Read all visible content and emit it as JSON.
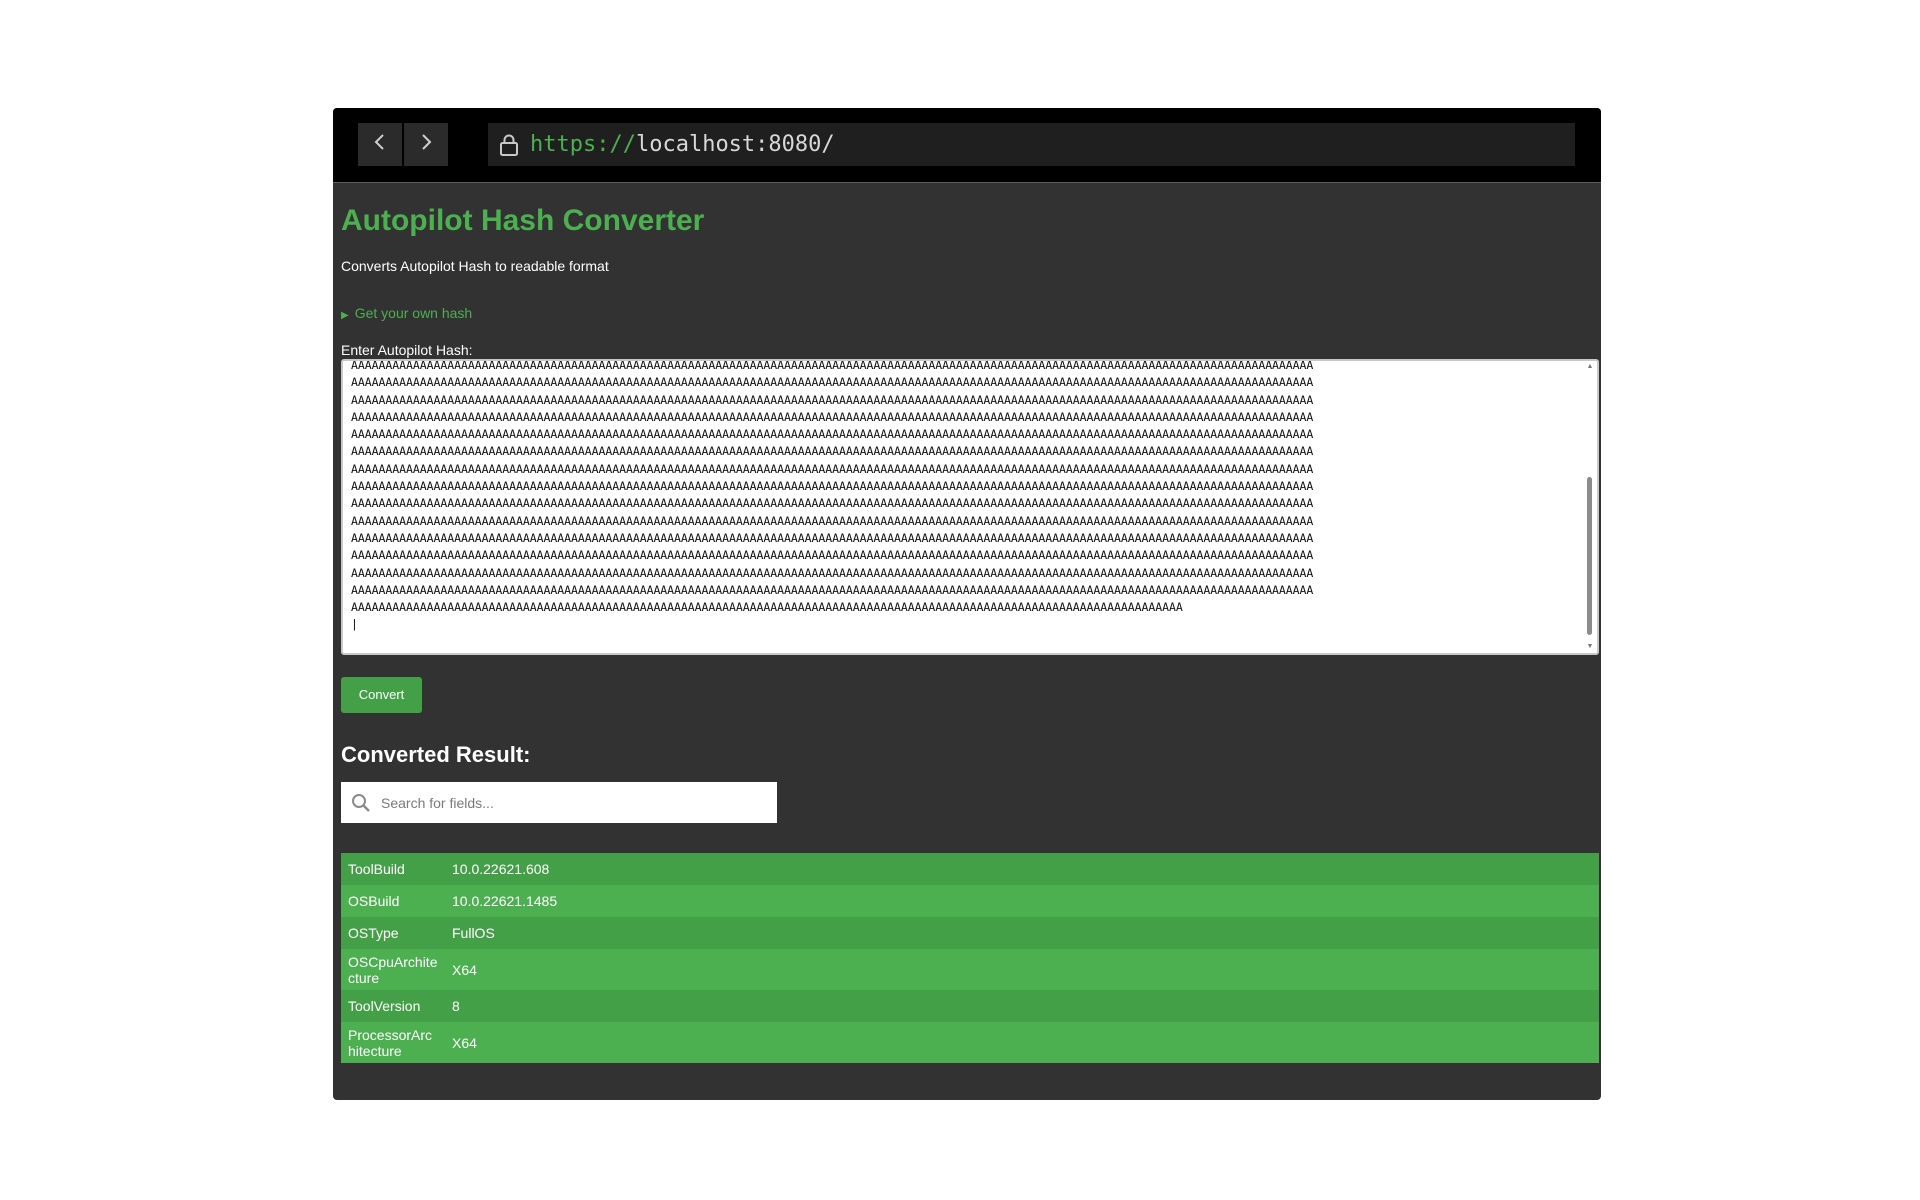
{
  "browser": {
    "url_scheme": "https://",
    "url_host": "localhost:8080/"
  },
  "page": {
    "title": "Autopilot Hash Converter",
    "subtitle": "Converts Autopilot Hash to readable format",
    "details_summary": "Get your own hash",
    "hash_label": "Enter Autopilot Hash:",
    "hash_lines": [
      "AAAAAAAAAAAAAAAAAAAAAAAAAAAAAAAAAAAAAAAAAAAAAAAAAAAAAAAAAAAAAAAAAAAAAAAAAAAAAAAAAAAAAAAAAAAAAAAAAAAAAAAAAAAAAAAAAAAAAAAAAAAAAAAAAAAAAAAAAAAA",
      "AAAAAAAAAAAAAAAAAAAAAAAAAAAAAAAAAAAAAAAAAAAAAAAAAAAAAAAAAAAAAAAAAAAAAAAAAAAAAAAAAAAAAAAAAAAAAAAAAAAAAAAAAAAAAAAAAAAAAAAAAAAAAAAAAAAAAAAAAAAA",
      "AAAAAAAAAAAAAAAAAAAAAAAAAAAAAAAAAAAAAAAAAAAAAAAAAAAAAAAAAAAAAAAAAAAAAAAAAAAAAAAAAAAAAAAAAAAAAAAAAAAAAAAAAAAAAAAAAAAAAAAAAAAAAAAAAAAAAAAAAAAA",
      "AAAAAAAAAAAAAAAAAAAAAAAAAAAAAAAAAAAAAAAAAAAAAAAAAAAAAAAAAAAAAAAAAAAAAAAAAAAAAAAAAAAAAAAAAAAAAAAAAAAAAAAAAAAAAAAAAAAAAAAAAAAAAAAAAAAAAAAAAAAA",
      "AAAAAAAAAAAAAAAAAAAAAAAAAAAAAAAAAAAAAAAAAAAAAAAAAAAAAAAAAAAAAAAAAAAAAAAAAAAAAAAAAAAAAAAAAAAAAAAAAAAAAAAAAAAAAAAAAAAAAAAAAAAAAAAAAAAAAAAAAAAA",
      "AAAAAAAAAAAAAAAAAAAAAAAAAAAAAAAAAAAAAAAAAAAAAAAAAAAAAAAAAAAAAAAAAAAAAAAAAAAAAAAAAAAAAAAAAAAAAAAAAAAAAAAAAAAAAAAAAAAAAAAAAAAAAAAAAAAAAAAAAAAA",
      "AAAAAAAAAAAAAAAAAAAAAAAAAAAAAAAAAAAAAAAAAAAAAAAAAAAAAAAAAAAAAAAAAAAAAAAAAAAAAAAAAAAAAAAAAAAAAAAAAAAAAAAAAAAAAAAAAAAAAAAAAAAAAAAAAAAAAAAAAAAA",
      "AAAAAAAAAAAAAAAAAAAAAAAAAAAAAAAAAAAAAAAAAAAAAAAAAAAAAAAAAAAAAAAAAAAAAAAAAAAAAAAAAAAAAAAAAAAAAAAAAAAAAAAAAAAAAAAAAAAAAAAAAAAAAAAAAAAAAAAAAAAA",
      "AAAAAAAAAAAAAAAAAAAAAAAAAAAAAAAAAAAAAAAAAAAAAAAAAAAAAAAAAAAAAAAAAAAAAAAAAAAAAAAAAAAAAAAAAAAAAAAAAAAAAAAAAAAAAAAAAAAAAAAAAAAAAAAAAAAAAAAAAAAA",
      "AAAAAAAAAAAAAAAAAAAAAAAAAAAAAAAAAAAAAAAAAAAAAAAAAAAAAAAAAAAAAAAAAAAAAAAAAAAAAAAAAAAAAAAAAAAAAAAAAAAAAAAAAAAAAAAAAAAAAAAAAAAAAAAAAAAAAAAAAAAA",
      "AAAAAAAAAAAAAAAAAAAAAAAAAAAAAAAAAAAAAAAAAAAAAAAAAAAAAAAAAAAAAAAAAAAAAAAAAAAAAAAAAAAAAAAAAAAAAAAAAAAAAAAAAAAAAAAAAAAAAAAAAAAAAAAAAAAAAAAAAAAA",
      "AAAAAAAAAAAAAAAAAAAAAAAAAAAAAAAAAAAAAAAAAAAAAAAAAAAAAAAAAAAAAAAAAAAAAAAAAAAAAAAAAAAAAAAAAAAAAAAAAAAAAAAAAAAAAAAAAAAAAAAAAAAAAAAAAAAAAAAAAAAA",
      "AAAAAAAAAAAAAAAAAAAAAAAAAAAAAAAAAAAAAAAAAAAAAAAAAAAAAAAAAAAAAAAAAAAAAAAAAAAAAAAAAAAAAAAAAAAAAAAAAAAAAAAAAAAAAAAAAAAAAAAAAAAAAAAAAAAAAAAAAAAA",
      "AAAAAAAAAAAAAAAAAAAAAAAAAAAAAAAAAAAAAAAAAAAAAAAAAAAAAAAAAAAAAAAAAAAAAAAAAAAAAAAAAAAAAAAAAAAAAAAAAAAAAAAAAAAAAAAAAAAAAAAAAAAAAAAAAAAAAAAAAAAA",
      "AAAAAAAAAAAAAAAAAAAAAAAAAAAAAAAAAAAAAAAAAAAAAAAAAAAAAAAAAAAAAAAAAAAAAAAAAAAAAAAAAAAAAAAAAAAAAAAAAAAAAAAAAAAAAAAAAAAAAAAAA",
      ""
    ],
    "convert_label": "Convert",
    "result_title": "Converted Result:",
    "search_placeholder": "Search for fields...",
    "results": [
      {
        "key": "ToolBuild",
        "value": "10.0.22621.608"
      },
      {
        "key": "OSBuild",
        "value": "10.0.22621.1485"
      },
      {
        "key": "OSType",
        "value": "FullOS"
      },
      {
        "key": "OSCpuArchitecture",
        "value": "X64"
      },
      {
        "key": "ToolVersion",
        "value": "8"
      },
      {
        "key": "ProcessorArchitecture",
        "value": "X64"
      }
    ]
  },
  "colors": {
    "accent": "#4caf50",
    "row_odd": "#43a047",
    "row_even": "#4caf50",
    "page_bg": "#323232",
    "chrome_bg": "#000000"
  },
  "icons": {
    "back": "chevron-left-icon",
    "forward": "chevron-right-icon",
    "lock": "lock-icon",
    "search": "search-icon",
    "details": "triangle-right-icon"
  }
}
